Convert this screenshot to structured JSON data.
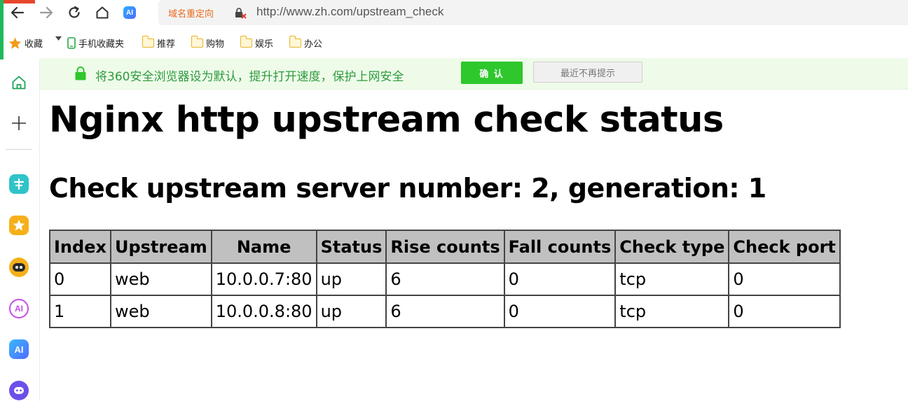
{
  "browser": {
    "redirect_label": "域名重定向",
    "url": "http://www.zh.com/upstream_check",
    "ai_badge": "AI"
  },
  "bookmarks": [
    {
      "label": "收藏",
      "icon": "star-icon"
    },
    {
      "label": "手机收藏夹",
      "icon": "phone-icon"
    },
    {
      "label": "推荐",
      "icon": "folder-icon"
    },
    {
      "label": "购物",
      "icon": "folder-icon"
    },
    {
      "label": "娱乐",
      "icon": "folder-icon"
    },
    {
      "label": "办公",
      "icon": "folder-icon"
    }
  ],
  "notification": {
    "text": "将360安全浏览器设为默认，提升打开速度，保护上网安全",
    "confirm_label": "确 认",
    "dismiss_label": "最近不再提示"
  },
  "sidebar": {
    "apps": [
      {
        "icon": "translate-app-icon",
        "color": "#2fc4c8"
      },
      {
        "icon": "favorites-app-icon",
        "color": "#f5b01a"
      },
      {
        "icon": "robot-app-icon",
        "color": "#f5b01a"
      },
      {
        "icon": "ai-circle-app-icon",
        "color": "#c54fe8"
      },
      {
        "icon": "ai-app-icon",
        "color": "#3a8bff"
      },
      {
        "icon": "chat-app-icon",
        "color": "#6b4fe8"
      }
    ]
  },
  "page": {
    "title": "Nginx http upstream check status",
    "subtitle": "Check upstream server number: 2, generation: 1"
  },
  "table": {
    "headers": [
      "Index",
      "Upstream",
      "Name",
      "Status",
      "Rise counts",
      "Fall counts",
      "Check type",
      "Check port"
    ],
    "rows": [
      [
        "0",
        "web",
        "10.0.0.7:80",
        "up",
        "6",
        "0",
        "tcp",
        "0"
      ],
      [
        "1",
        "web",
        "10.0.0.8:80",
        "up",
        "6",
        "0",
        "tcp",
        "0"
      ]
    ]
  }
}
